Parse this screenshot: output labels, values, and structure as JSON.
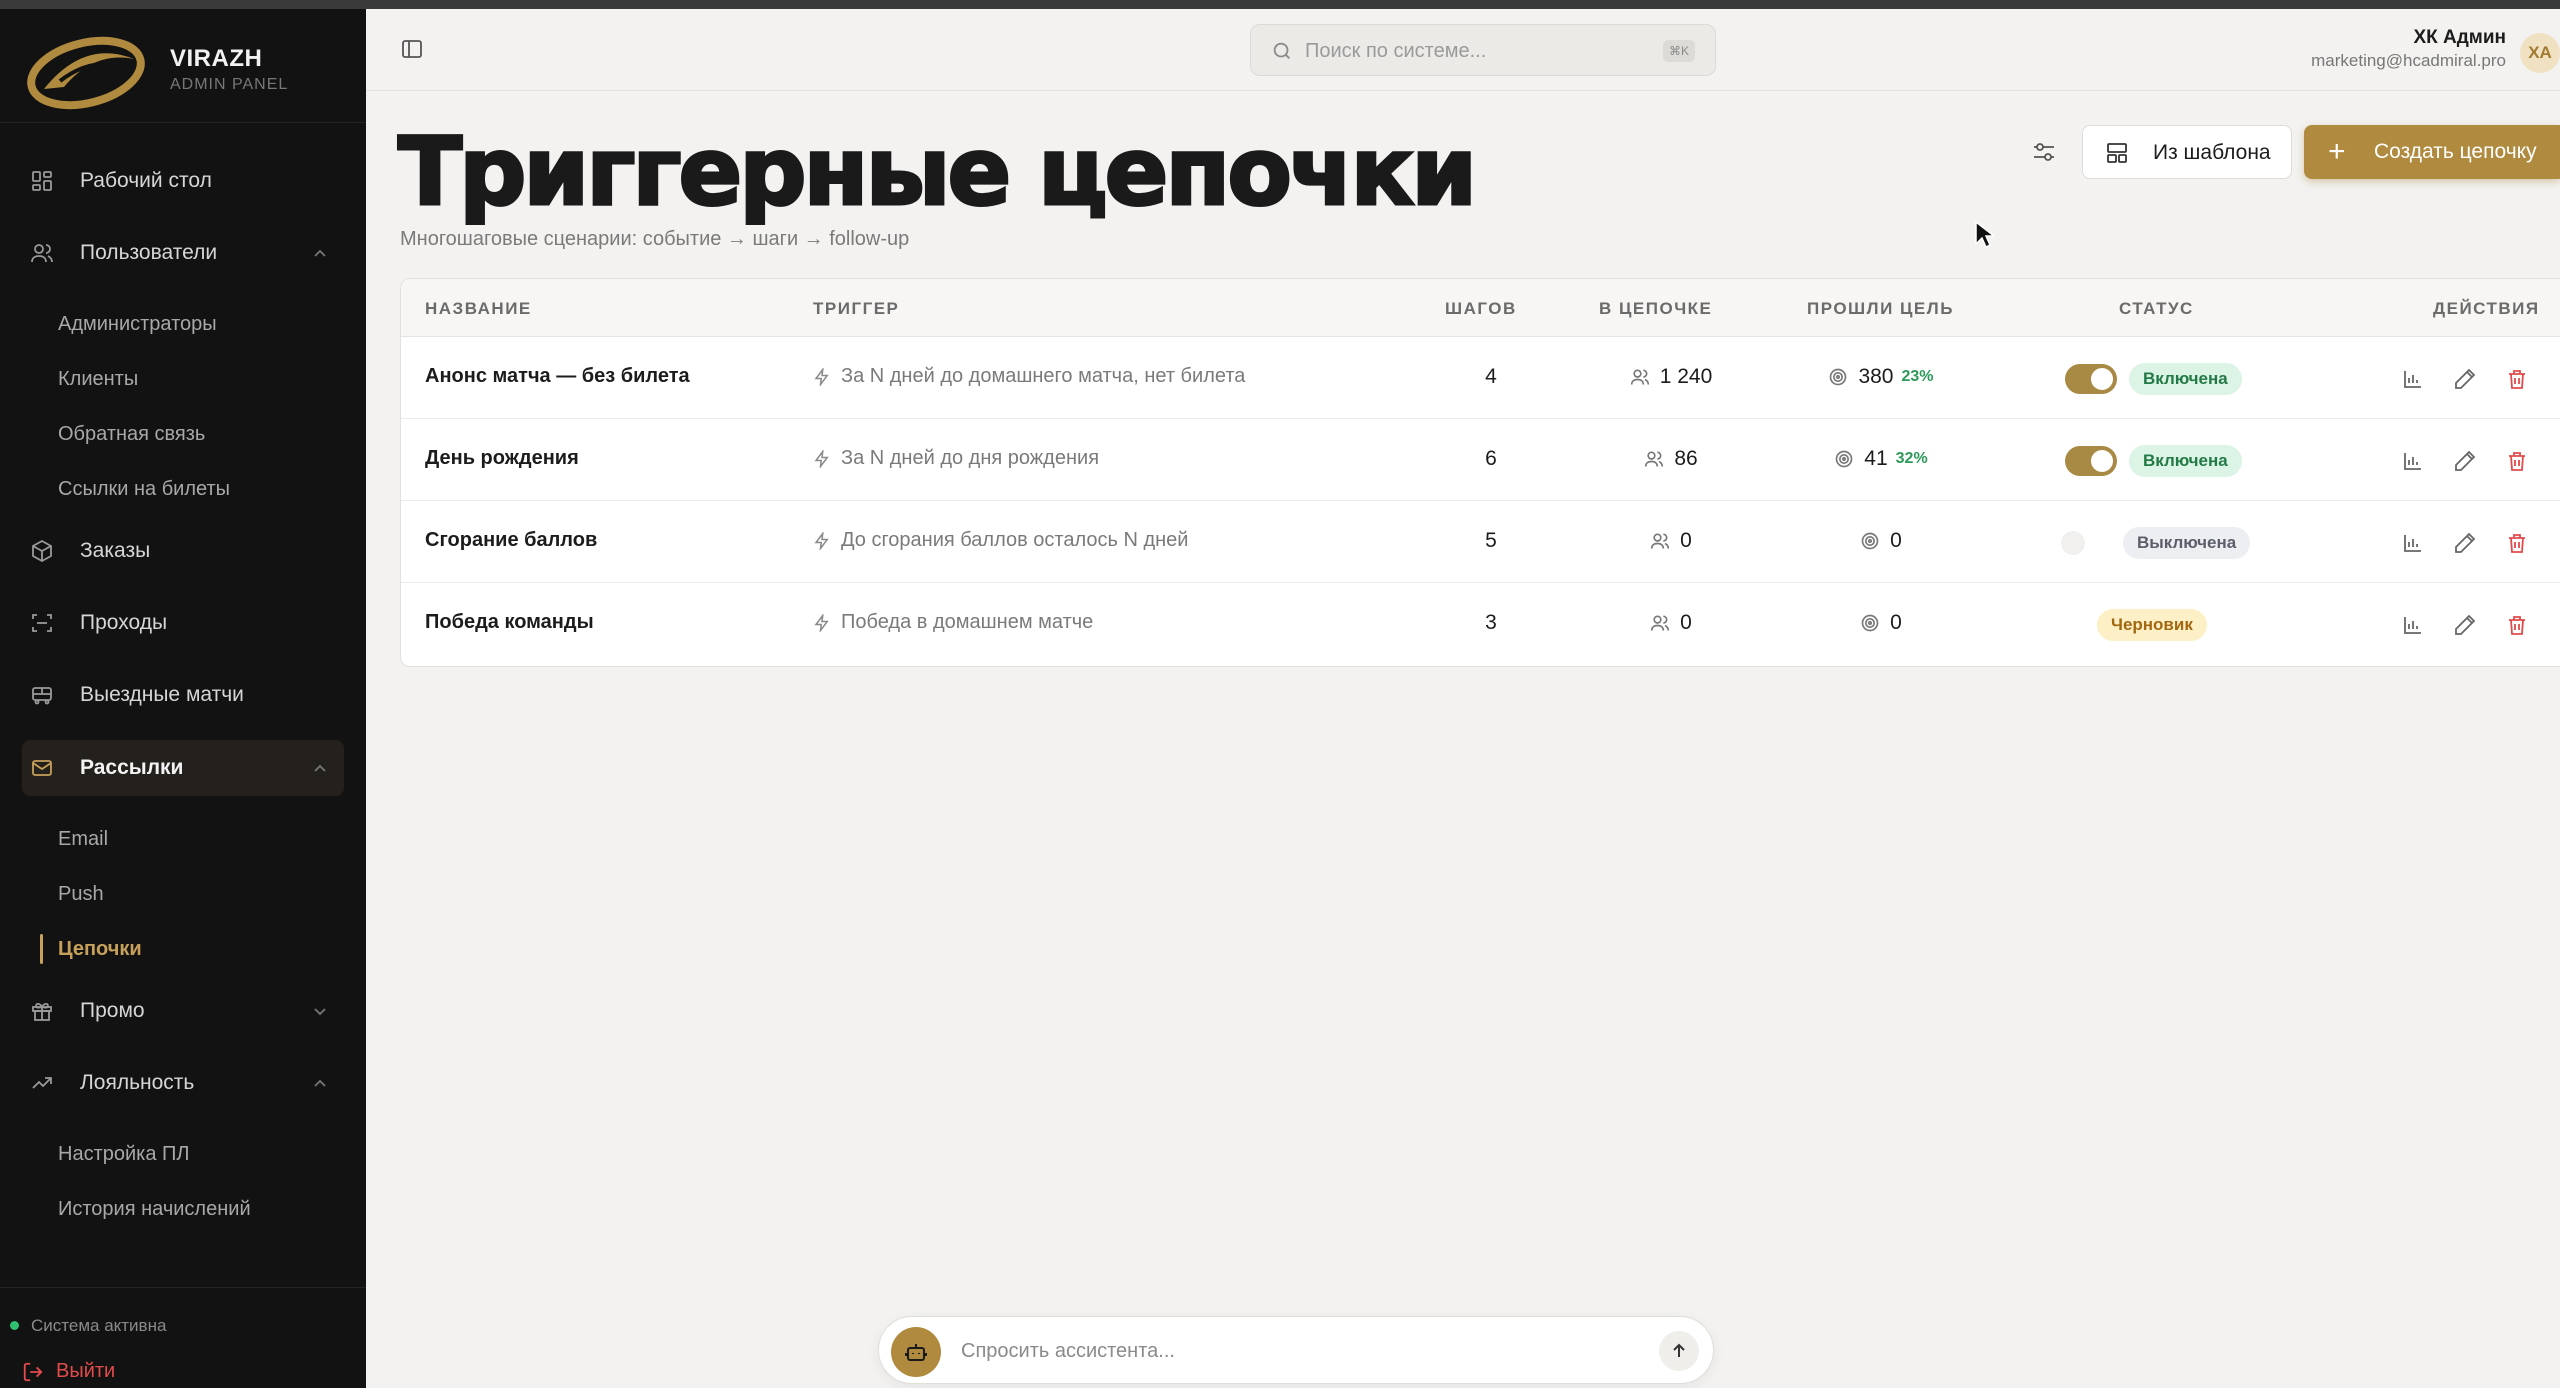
{
  "app": {
    "brand_name": "VIRAZH",
    "brand_sub": "ADMIN PANEL"
  },
  "sidebar": {
    "items": [
      {
        "label": "Рабочий стол",
        "icon": "dashboard-icon"
      },
      {
        "label": "Пользователи",
        "icon": "users-icon",
        "expanded": true,
        "children": [
          "Администраторы",
          "Клиенты",
          "Обратная связь",
          "Ссылки на билеты"
        ]
      },
      {
        "label": "Заказы",
        "icon": "box-icon"
      },
      {
        "label": "Проходы",
        "icon": "scan-icon"
      },
      {
        "label": "Выездные матчи",
        "icon": "bus-icon"
      },
      {
        "label": "Рассылки",
        "icon": "mail-icon",
        "expanded": true,
        "active": true,
        "children": [
          "Email",
          "Push",
          "Цепочки"
        ],
        "active_child": "Цепочки"
      },
      {
        "label": "Промо",
        "icon": "gift-icon",
        "expanded": false
      },
      {
        "label": "Лояльность",
        "icon": "trending-icon",
        "expanded": true,
        "children": [
          "Настройка ПЛ",
          "История начислений"
        ]
      }
    ],
    "system_status": "Система активна",
    "logout_label": "Выйти"
  },
  "header": {
    "search_placeholder": "Поиск по системе...",
    "search_shortcut": "⌘K",
    "user_name": "ХК Админ",
    "user_email": "marketing@hcadmiral.pro",
    "avatar_initials": "ХА"
  },
  "page": {
    "title": "Триггерные цепочки",
    "subtitle": "Многошаговые сценарии: событие → шаги → follow-up",
    "template_button": "Из шаблона",
    "create_button": "Создать цепочку"
  },
  "table": {
    "columns": [
      "НАЗВАНИЕ",
      "ТРИГГЕР",
      "ШАГОВ",
      "В ЦЕПОЧКЕ",
      "ПРОШЛИ ЦЕЛЬ",
      "СТАТУС",
      "ДЕЙСТВИЯ"
    ],
    "rows": [
      {
        "name": "Анонс матча — без билета",
        "trigger": "За N дней до домашнего матча, нет билета",
        "steps": "4",
        "in_chain": "1 240",
        "goal": "380",
        "goal_pct": "23%",
        "toggle": "on",
        "status": "Включена",
        "status_kind": "on"
      },
      {
        "name": "День рождения",
        "trigger": "За N дней до дня рождения",
        "steps": "6",
        "in_chain": "86",
        "goal": "41",
        "goal_pct": "32%",
        "toggle": "on",
        "status": "Включена",
        "status_kind": "on"
      },
      {
        "name": "Сгорание баллов",
        "trigger": "До сгорания баллов осталось N дней",
        "steps": "5",
        "in_chain": "0",
        "goal": "0",
        "goal_pct": "",
        "toggle": "off",
        "status": "Выключена",
        "status_kind": "off"
      },
      {
        "name": "Победа команды",
        "trigger": "Победа в домашнем матче",
        "steps": "3",
        "in_chain": "0",
        "goal": "0",
        "goal_pct": "",
        "toggle": "none",
        "status": "Черновик",
        "status_kind": "draft"
      }
    ]
  },
  "assistant": {
    "placeholder": "Спросить ассистента..."
  },
  "colors": {
    "accent": "#b08a3e",
    "sidebar_bg": "#121212",
    "page_bg": "#f3f2f0",
    "danger": "#e24b4b",
    "success": "#2c9a5a"
  }
}
